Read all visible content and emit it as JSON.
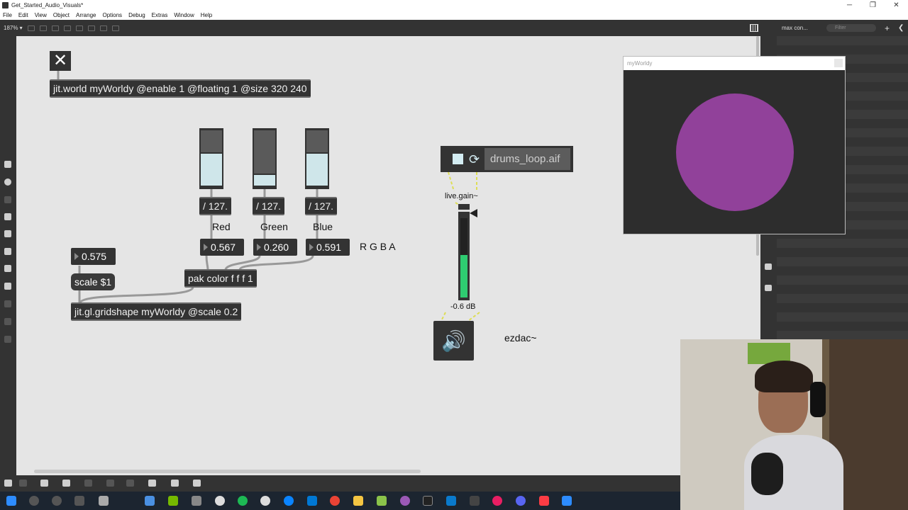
{
  "window": {
    "title": "Get_Started_Audio_Visuals*",
    "minimize": "─",
    "restore": "❐",
    "close": "✕"
  },
  "menu": [
    "File",
    "Edit",
    "View",
    "Object",
    "Arrange",
    "Options",
    "Debug",
    "Extras",
    "Window",
    "Help"
  ],
  "toolbar": {
    "zoom": "187% ▾"
  },
  "sidepanel": {
    "tab": "max con...",
    "filter_placeholder": "Filter",
    "plus": "+",
    "collapse": "❮"
  },
  "patch": {
    "close_glyph": "✕",
    "jit_world": "jit.world myWorldy @enable 1 @floating 1 @size 320 240",
    "divide_red": "/ 127.",
    "divide_green": "/ 127.",
    "divide_blue": "/ 127.",
    "label_red": "Red",
    "label_green": "Green",
    "label_blue": "Blue",
    "label_rgba": "R G B A",
    "num_red": "0.567",
    "num_green": "0.260",
    "num_blue": "0.591",
    "num_scale": "0.575",
    "scale_msg": "scale $1",
    "pak": "pak color f f f 1",
    "gridshape": "jit.gl.gridshape myWorldy @scale 0.2",
    "sliders": [
      0.6,
      0.22,
      0.6
    ],
    "player_file": "drums_loop.aif",
    "live_gain": "live.gain~",
    "gain_db": "-0.6 dB",
    "gain_level": 0.48,
    "ezdac_label": "ezdac~",
    "speaker_glyph": "🔊",
    "loop_glyph": "⟳"
  },
  "jitwindow": {
    "title": "myWorldy",
    "circle_color": "#91419a"
  },
  "colors": {
    "canvas": "#e5e5e5",
    "object": "#333333",
    "accent": "#d3ecf2",
    "meter": "#2ecc71"
  }
}
